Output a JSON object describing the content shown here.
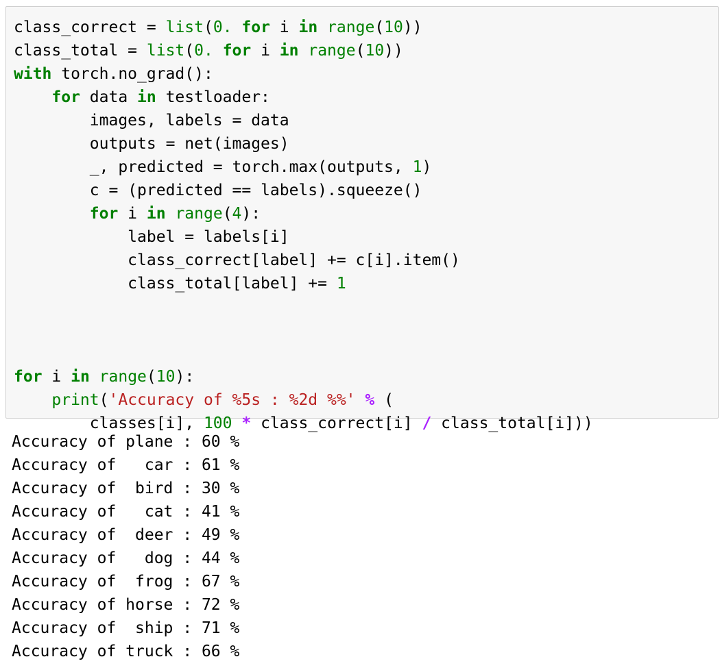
{
  "input_cell": {
    "lines": [
      [
        {
          "t": "class_correct ",
          "c": "plain"
        },
        {
          "t": "=",
          "c": "op"
        },
        {
          "t": " ",
          "c": "plain"
        },
        {
          "t": "list",
          "c": "builtin"
        },
        {
          "t": "(",
          "c": "plain"
        },
        {
          "t": "0.",
          "c": "num"
        },
        {
          "t": " ",
          "c": "plain"
        },
        {
          "t": "for",
          "c": "kw"
        },
        {
          "t": " i ",
          "c": "plain"
        },
        {
          "t": "in",
          "c": "kw"
        },
        {
          "t": " ",
          "c": "plain"
        },
        {
          "t": "range",
          "c": "builtin"
        },
        {
          "t": "(",
          "c": "plain"
        },
        {
          "t": "10",
          "c": "num"
        },
        {
          "t": "))",
          "c": "plain"
        }
      ],
      [
        {
          "t": "class_total ",
          "c": "plain"
        },
        {
          "t": "=",
          "c": "op"
        },
        {
          "t": " ",
          "c": "plain"
        },
        {
          "t": "list",
          "c": "builtin"
        },
        {
          "t": "(",
          "c": "plain"
        },
        {
          "t": "0.",
          "c": "num"
        },
        {
          "t": " ",
          "c": "plain"
        },
        {
          "t": "for",
          "c": "kw"
        },
        {
          "t": " i ",
          "c": "plain"
        },
        {
          "t": "in",
          "c": "kw"
        },
        {
          "t": " ",
          "c": "plain"
        },
        {
          "t": "range",
          "c": "builtin"
        },
        {
          "t": "(",
          "c": "plain"
        },
        {
          "t": "10",
          "c": "num"
        },
        {
          "t": "))",
          "c": "plain"
        }
      ],
      [
        {
          "t": "with",
          "c": "kw"
        },
        {
          "t": " torch.no_grad():",
          "c": "plain"
        }
      ],
      [
        {
          "t": "    ",
          "c": "plain"
        },
        {
          "t": "for",
          "c": "kw"
        },
        {
          "t": " data ",
          "c": "plain"
        },
        {
          "t": "in",
          "c": "kw"
        },
        {
          "t": " testloader:",
          "c": "plain"
        }
      ],
      [
        {
          "t": "        images, labels ",
          "c": "plain"
        },
        {
          "t": "=",
          "c": "op"
        },
        {
          "t": " data",
          "c": "plain"
        }
      ],
      [
        {
          "t": "        outputs ",
          "c": "plain"
        },
        {
          "t": "=",
          "c": "op"
        },
        {
          "t": " net(images)",
          "c": "plain"
        }
      ],
      [
        {
          "t": "        _, predicted ",
          "c": "plain"
        },
        {
          "t": "=",
          "c": "op"
        },
        {
          "t": " torch.max(outputs, ",
          "c": "plain"
        },
        {
          "t": "1",
          "c": "num"
        },
        {
          "t": ")",
          "c": "plain"
        }
      ],
      [
        {
          "t": "        c ",
          "c": "plain"
        },
        {
          "t": "=",
          "c": "op"
        },
        {
          "t": " (predicted ",
          "c": "plain"
        },
        {
          "t": "==",
          "c": "op"
        },
        {
          "t": " labels).squeeze()",
          "c": "plain"
        }
      ],
      [
        {
          "t": "        ",
          "c": "plain"
        },
        {
          "t": "for",
          "c": "kw"
        },
        {
          "t": " i ",
          "c": "plain"
        },
        {
          "t": "in",
          "c": "kw"
        },
        {
          "t": " ",
          "c": "plain"
        },
        {
          "t": "range",
          "c": "builtin"
        },
        {
          "t": "(",
          "c": "plain"
        },
        {
          "t": "4",
          "c": "num"
        },
        {
          "t": "):",
          "c": "plain"
        }
      ],
      [
        {
          "t": "            label ",
          "c": "plain"
        },
        {
          "t": "=",
          "c": "op"
        },
        {
          "t": " labels[i]",
          "c": "plain"
        }
      ],
      [
        {
          "t": "            class_correct[label] ",
          "c": "plain"
        },
        {
          "t": "+=",
          "c": "op"
        },
        {
          "t": " c[i].item()",
          "c": "plain"
        }
      ],
      [
        {
          "t": "            class_total[label] ",
          "c": "plain"
        },
        {
          "t": "+=",
          "c": "op"
        },
        {
          "t": " ",
          "c": "plain"
        },
        {
          "t": "1",
          "c": "num"
        }
      ],
      [
        {
          "t": "",
          "c": "plain"
        }
      ],
      [
        {
          "t": "",
          "c": "plain"
        }
      ],
      [
        {
          "t": "",
          "c": "plain"
        }
      ],
      [
        {
          "t": "for",
          "c": "kw"
        },
        {
          "t": " i ",
          "c": "plain"
        },
        {
          "t": "in",
          "c": "kw"
        },
        {
          "t": " ",
          "c": "plain"
        },
        {
          "t": "range",
          "c": "builtin"
        },
        {
          "t": "(",
          "c": "plain"
        },
        {
          "t": "10",
          "c": "num"
        },
        {
          "t": "):",
          "c": "plain"
        }
      ],
      [
        {
          "t": "    ",
          "c": "plain"
        },
        {
          "t": "print",
          "c": "builtin"
        },
        {
          "t": "(",
          "c": "plain"
        },
        {
          "t": "'Accuracy of %5s : %2d %%'",
          "c": "str"
        },
        {
          "t": " ",
          "c": "plain"
        },
        {
          "t": "%",
          "c": "opm"
        },
        {
          "t": " (",
          "c": "plain"
        }
      ],
      [
        {
          "t": "        classes[i], ",
          "c": "plain"
        },
        {
          "t": "100",
          "c": "num"
        },
        {
          "t": " ",
          "c": "plain"
        },
        {
          "t": "*",
          "c": "opm"
        },
        {
          "t": " class_correct[i] ",
          "c": "plain"
        },
        {
          "t": "/",
          "c": "opm"
        },
        {
          "t": " class_total[i]))",
          "c": "plain"
        }
      ]
    ]
  },
  "output": {
    "lines": [
      "Accuracy of plane : 60 %",
      "Accuracy of   car : 61 %",
      "Accuracy of  bird : 30 %",
      "Accuracy of   cat : 41 %",
      "Accuracy of  deer : 49 %",
      "Accuracy of   dog : 44 %",
      "Accuracy of  frog : 67 %",
      "Accuracy of horse : 72 %",
      "Accuracy of  ship : 71 %",
      "Accuracy of truck : 66 %"
    ]
  }
}
